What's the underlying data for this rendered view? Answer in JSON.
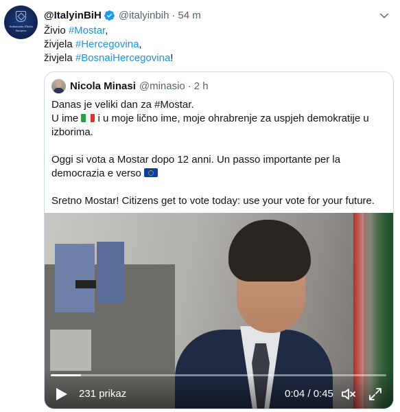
{
  "tweet": {
    "avatar_text": [
      "Ambasciata d'Italia",
      "Sarajevo"
    ],
    "display_name": "@ItalyinBiH",
    "verified_icon": "verified-badge-icon",
    "handle": "@italyinbih",
    "separator": "·",
    "time": "54 m",
    "lines": [
      {
        "prefix": "Živio ",
        "hashtag": "#Mostar",
        "suffix": ","
      },
      {
        "prefix": "živjela ",
        "hashtag": "#Hercegovina",
        "suffix": ","
      },
      {
        "prefix": "živjela ",
        "hashtag": "#BosnaiHercegovina",
        "suffix": "!"
      }
    ],
    "hashtag_color": "#1b95e0"
  },
  "quoted_tweet": {
    "display_name": "Nicola Minasi",
    "handle": "@minasio",
    "separator": "·",
    "time": "2 h",
    "paragraphs": {
      "l1": "Danas je veliki dan za #Mostar.",
      "l2_before": "U ime ",
      "l2_after": " i u moje lično ime, moje ohrabrenje za uspjeh demokratije u",
      "l3": "izborima.",
      "l4": "Oggi si vota a Mostar dopo 12 anni. Un passo importante per la",
      "l5_before": "democrazia e verso ",
      "l6": "Sretno Mostar! Citizens get to vote today: use your vote for your future."
    },
    "flag_icons": [
      "italy-flag-icon",
      "eu-flag-icon"
    ]
  },
  "video": {
    "views": "231 prikaz",
    "time": "0:04 / 0:45",
    "progress": 0.09,
    "icons": [
      "play-icon",
      "mute-icon",
      "fullscreen-icon"
    ]
  }
}
